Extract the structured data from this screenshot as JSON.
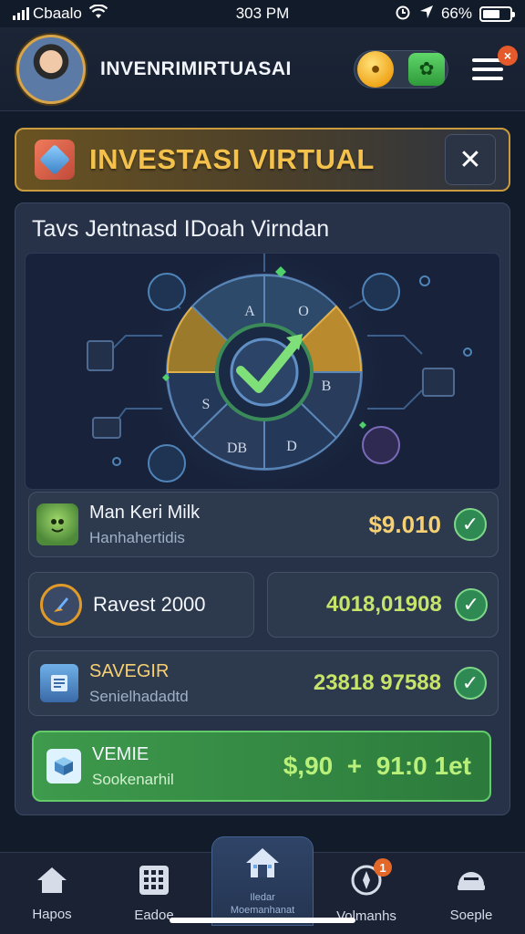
{
  "status_bar": {
    "carrier": "Cbaalo",
    "time": "303 PM",
    "battery": "66%",
    "battery_level": 0.66
  },
  "header": {
    "title": "INVENRIMIRTUASAI",
    "coin_icon": "coin-icon",
    "plant_icon": "plant-icon",
    "menu_badge": "×"
  },
  "banner": {
    "title": "INVESTASI VIRTUAL",
    "close_label": "✕"
  },
  "panel": {
    "subtitle": "Tavs Jentnasd IDoah Virndan",
    "dial_labels": [
      "A",
      "O",
      "B",
      "S",
      "DB",
      "D"
    ]
  },
  "rows": [
    {
      "title": "Man Keri Milk",
      "subtitle": "Hanhahertidis",
      "value": "$9.010"
    },
    {
      "title": "Ravest 2000",
      "value": "4018,01908"
    },
    {
      "title": "SAVEGIR",
      "subtitle": "Senielhadadtd",
      "value": "23818 97588"
    },
    {
      "title": "VEMIE",
      "subtitle": "Sookenarhil",
      "value": "$,90  +  91:0 1et"
    }
  ],
  "nav": [
    {
      "label": "Hapos",
      "icon": "home-icon"
    },
    {
      "label": "Eadoe",
      "icon": "grid-icon"
    },
    {
      "label": "Iledar",
      "sublabel": "Moemanhanat",
      "icon": "house-icon"
    },
    {
      "label": "Volmanhs",
      "icon": "compass-icon",
      "badge": "1"
    },
    {
      "label": "Soeple",
      "icon": "helmet-icon"
    }
  ],
  "colors": {
    "accent_gold": "#f4c24c",
    "success_green": "#2e8a52",
    "panel_bg": "#273248",
    "background": "#121b2a"
  }
}
